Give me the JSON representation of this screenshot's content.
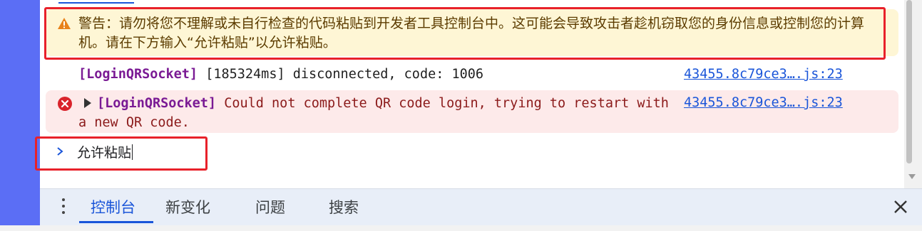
{
  "console": {
    "warning_text": "警告：请勿将您不理解或未自行检查的代码粘贴到开发者工具控制台中。这可能会导致攻击者趁机窃取您的身份信息或控制您的计算机。请在下方输入“允许粘贴”以允许粘贴。",
    "log": {
      "tag": "[LoginQRSocket]",
      "message": " [185324ms] disconnected, code: 1006",
      "source": "43455.8c79ce3….js:23"
    },
    "error": {
      "tag": "[LoginQRSocket]",
      "message": " Could not complete QR code login, trying to restart with a new QR code.",
      "source": "43455.8c79ce3….js:23"
    },
    "prompt_input_value": "允许粘贴"
  },
  "drawer": {
    "tabs": [
      {
        "label": "控制台",
        "active": true
      },
      {
        "label": "新变化",
        "active": false
      },
      {
        "label": "问题",
        "active": false
      },
      {
        "label": "搜索",
        "active": false
      }
    ]
  },
  "icons": {
    "warning": "warning-triangle-icon",
    "error": "error-circle-icon",
    "expand": "triangle-right-icon",
    "prompt": "chevron-right-icon",
    "menu": "more-vertical-icon",
    "close": "close-icon"
  },
  "colors": {
    "accent": "#1a55d9",
    "warning_bg": "#fef6d5",
    "error_bg": "#fdeaea",
    "highlight_box": "#e8212a",
    "left_strip": "#5b6ef5"
  }
}
